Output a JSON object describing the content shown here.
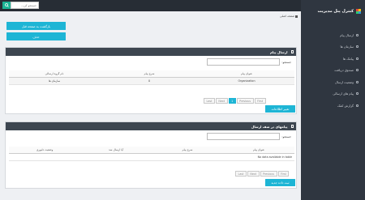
{
  "topbar": {
    "search_placeholder": "جستجو کن..."
  },
  "sidebar": {
    "brand_title": "کنترل پنل مدیریت",
    "items": [
      {
        "label": "ارسال پیام"
      },
      {
        "label": "سازمان ها"
      },
      {
        "label": "پیامک ها"
      },
      {
        "label": "صندوق دریافت"
      },
      {
        "label": "وضعیت ارسال"
      },
      {
        "label": "پیام های ارسالی"
      },
      {
        "label": "گزارش کمک"
      }
    ]
  },
  "breadcrumb": {
    "home": "صفحه اصلی"
  },
  "buttons": {
    "back": "بازگشت به صفحه قبل",
    "delete": "حذف"
  },
  "panel1": {
    "title": "ارسال پیام",
    "search_label": "جستجو:",
    "columns": [
      "عنوان پیام",
      "شرح پیام",
      "نام گروه ارسالی"
    ],
    "rows": [
      [
        "Organization",
        "0",
        "سازمان ها"
      ]
    ],
    "pager": [
      "First",
      "Previous",
      "1",
      "Next",
      "Last"
    ],
    "action_button": "تغییر اطلاعات"
  },
  "panel2": {
    "title": "پیامهای در صف ارسال",
    "search_label": "جستجو:",
    "columns": [
      "عنوان پیام",
      "شرح پیام",
      "آیا ارسال شد",
      "وضعیت دلیوری"
    ],
    "empty_text": "No data available in table",
    "pager": [
      "First",
      "Previous",
      "Next",
      "Last"
    ],
    "action_button": "ثبت داده جدید"
  },
  "colors": {
    "sidebar": "#2f3640",
    "topbar": "#272d35",
    "accent_teal": "#1eb5d5",
    "search_green": "#1bb394",
    "panel_header": "#3d4650"
  }
}
